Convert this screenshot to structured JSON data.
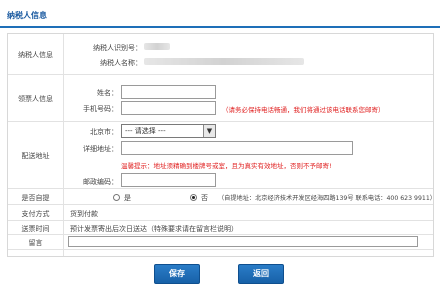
{
  "header": {
    "title": "纳税人信息"
  },
  "taxpayer": {
    "section_label": "纳税人信息",
    "id_label": "纳税人识别号：",
    "name_label": "纳税人名称："
  },
  "recipient": {
    "section_label": "领票人信息",
    "name_label": "姓名：",
    "phone_label": "手机号码：",
    "phone_note": "（请务必保持电话畅通，我们将通过该电话联系您邮寄）"
  },
  "delivery": {
    "section_label": "配送地址",
    "city_label": "北京市：",
    "city_select_value": "--- 请选择 ---",
    "detail_label": "详细地址：",
    "warning": "温馨提示：地址须精确到楼牌号或室，且为真实有效地址，否则不予邮寄!",
    "postcode_label": "邮政编码："
  },
  "pickup": {
    "label": "是否自提",
    "yes": "是",
    "no": "否",
    "selected": "否",
    "address_note": "（自提地址：北京经济技术开发区经海四路139号 联系电话：400 623 9911）"
  },
  "payment": {
    "label": "支付方式",
    "value": "货到付款"
  },
  "delivery_time": {
    "label": "送票时间",
    "value": "预计发票寄出后次日送达（特殊要求请在留言栏说明）"
  },
  "message": {
    "label": "留言",
    "value": ""
  },
  "buttons": {
    "save": "保存",
    "back": "返回"
  }
}
